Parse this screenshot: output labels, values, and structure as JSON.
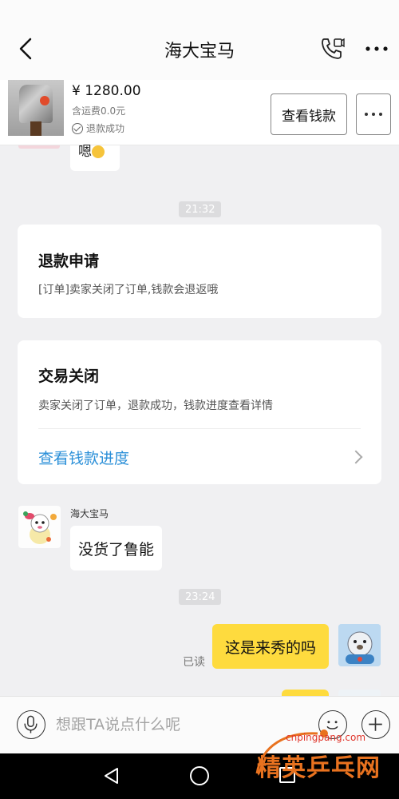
{
  "header": {
    "title": "海大宝马",
    "back_icon": "chevron-left-icon",
    "call_icon": "phone-icon",
    "more_icon": "more-dots-icon"
  },
  "product": {
    "price": "¥ 1280.00",
    "shipping": "含运费0.0元",
    "status": "退款成功",
    "view_money_label": "查看钱款"
  },
  "chat": {
    "partial_message": "嗯",
    "time_1": "21:32",
    "refund_card": {
      "title": "退款申请",
      "desc": "[订单]卖家关闭了订单,钱款会退返哦"
    },
    "closed_card": {
      "title": "交易关闭",
      "desc": "卖家关闭了订单，退款成功，钱款进度查看详情",
      "link": "查看钱款进度"
    },
    "sender_name": "海大宝马",
    "incoming_message": "没货了鲁能",
    "time_2": "23:24",
    "outgoing_message": "这是来秀的吗",
    "read_label": "已读"
  },
  "input": {
    "placeholder": "想跟TA说点什么呢"
  },
  "watermark": {
    "site": "cnpingpang.com",
    "text": "精英乒乓网"
  },
  "colors": {
    "accent_link": "#2a8fd8",
    "bubble_self": "#fedb3e",
    "background": "#f0f0f2"
  }
}
